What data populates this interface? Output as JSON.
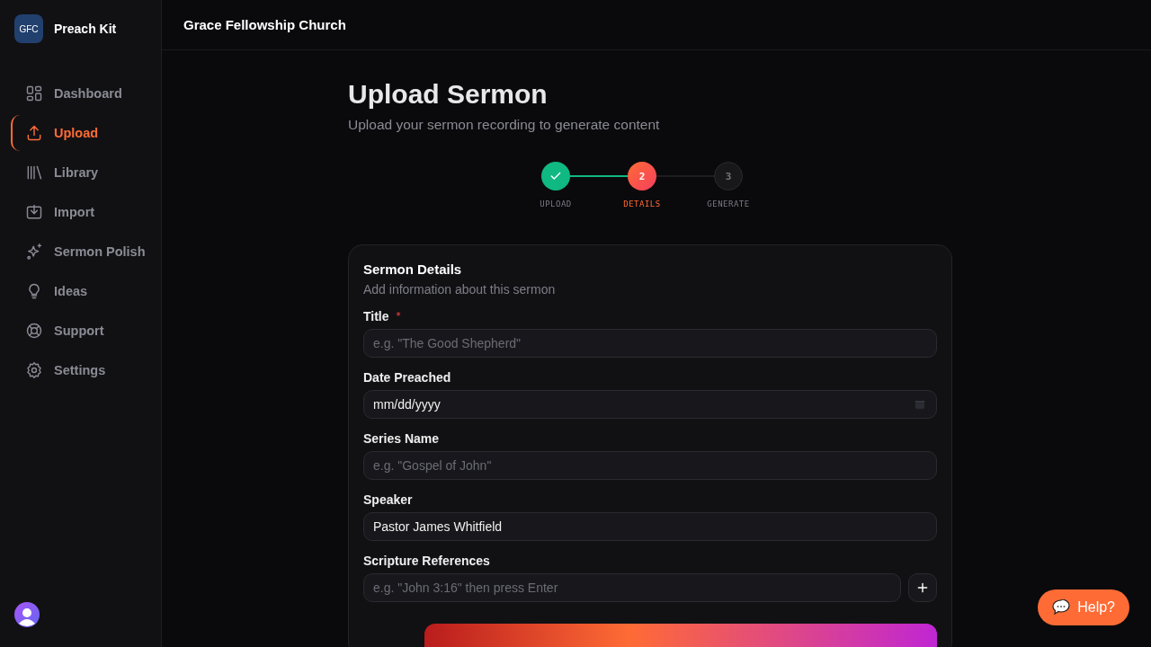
{
  "sidebar": {
    "logo": "GFC",
    "app_name": "Preach Kit",
    "items": [
      {
        "label": "Dashboard",
        "selected": false
      },
      {
        "label": "Upload",
        "selected": true
      },
      {
        "label": "Library",
        "selected": false
      },
      {
        "label": "Import",
        "selected": false
      },
      {
        "label": "Sermon Polish",
        "selected": false
      },
      {
        "label": "Ideas",
        "selected": false
      },
      {
        "label": "Support",
        "selected": false
      },
      {
        "label": "Settings",
        "selected": false
      }
    ]
  },
  "header": {
    "title": "Grace Fellowship Church"
  },
  "page": {
    "title": "Upload Sermon",
    "subtitle": "Upload your sermon recording to generate content"
  },
  "steps": [
    {
      "label": "UPLOAD",
      "completed": true,
      "selected": false
    },
    {
      "number": "2",
      "label": "DETAILS",
      "completed": false,
      "selected": true
    },
    {
      "number": "3",
      "label": "GENERATE",
      "completed": false,
      "selected": false
    }
  ],
  "card": {
    "title": "Sermon Details",
    "subtitle": "Add information about this sermon",
    "fields": [
      {
        "label": "Title",
        "required_mark": "*",
        "kind": "text",
        "placeholder": "e.g. \"The Good Shepherd\""
      },
      {
        "label": "Date Preached",
        "kind": "date",
        "value": "mm/dd/yyyy"
      },
      {
        "label": "Series Name",
        "kind": "text",
        "placeholder": "e.g. \"Gospel of John\""
      },
      {
        "label": "Speaker",
        "kind": "text",
        "value": "Pastor James Whitfield"
      },
      {
        "label": "Scripture References",
        "kind": "add",
        "placeholder": "e.g. \"John 3:16\" then press Enter"
      }
    ]
  },
  "help_button": {
    "label": "Help?"
  }
}
